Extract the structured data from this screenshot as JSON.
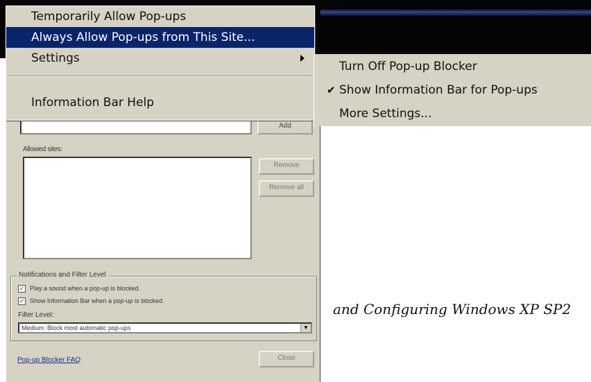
{
  "context_menu": {
    "items": [
      {
        "label": "Temporarily Allow Pop-ups"
      },
      {
        "label": "Always Allow Pop-ups from This Site..."
      },
      {
        "label": "Settings"
      },
      {
        "label": "Information Bar Help"
      }
    ],
    "highlighted_index": 1,
    "highlight_color": "#0a246a"
  },
  "submenu": {
    "items": [
      {
        "label": "Turn Off Pop-up Blocker",
        "checked": false
      },
      {
        "label": "Show Information Bar for Pop-ups",
        "checked": true
      },
      {
        "label": "More Settings..."
      }
    ],
    "check_glyph": "✔"
  },
  "dialog": {
    "add_button": "Add",
    "allowed_sites_label": "Allowed sites:",
    "remove_button": "Remove",
    "remove_all_button": "Remove all",
    "notifications_group_title": "Notifications and Filter Level",
    "play_sound_label": "Play a sound when a pop-up is blocked.",
    "play_sound_checked": true,
    "show_info_bar_label": "Show Information Bar when a pop-up is blocked.",
    "show_info_bar_checked": true,
    "filter_level_label": "Filter Level:",
    "filter_level_value": "Medium: Block most automatic pop-ups",
    "faq_link": "Pop-up Blocker FAQ",
    "close_button": "Close",
    "face_color": "#d6d2c4"
  },
  "caption": "and Configuring Windows XP SP2"
}
